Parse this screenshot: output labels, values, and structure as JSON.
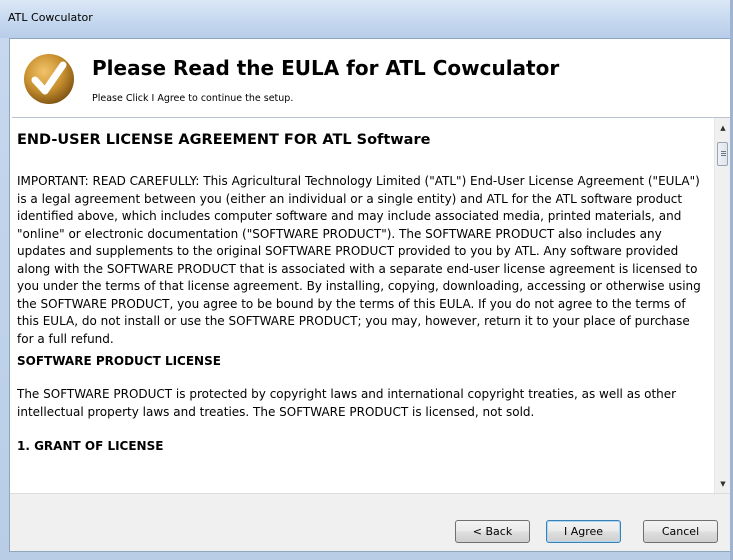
{
  "window": {
    "title": "ATL Cowculator"
  },
  "header": {
    "title": "Please Read the EULA for ATL Cowculator",
    "subtitle": "Please Click I Agree to continue the setup.",
    "logo_icon": "checkmark-logo-icon"
  },
  "eula": {
    "heading": "END-USER LICENSE AGREEMENT FOR ATL Software",
    "paragraph1": "IMPORTANT: READ CAREFULLY: This Agricultural Technology Limited (\"ATL\") End-User License Agreement (\"EULA\") is a legal agreement between you (either an individual or a single entity) and ATL for the ATL software product identified above, which includes computer software and may include associated media, printed materials, and \"online\" or electronic documentation (\"SOFTWARE PRODUCT\"). The SOFTWARE PRODUCT also includes any updates and supplements to the original SOFTWARE PRODUCT provided to you by ATL. Any software provided along with the SOFTWARE PRODUCT that is associated with a separate end-user license agreement is licensed to you under the terms of that license agreement. By installing, copying, downloading, accessing or otherwise using the SOFTWARE PRODUCT, you agree to be bound by the terms of this EULA. If you do not agree to the terms of this EULA, do not install or use the SOFTWARE PRODUCT; you may, however, return it to your place of purchase for a full refund.",
    "section1_heading": "SOFTWARE PRODUCT LICENSE",
    "paragraph2": "The SOFTWARE PRODUCT is protected by copyright laws and international copyright treaties, as well as other intellectual property laws and treaties. The SOFTWARE PRODUCT is licensed, not sold.",
    "section2_heading": "1. GRANT OF LICENSE"
  },
  "buttons": {
    "back": "< Back",
    "agree": "I Agree",
    "cancel": "Cancel"
  },
  "colors": {
    "accent_blue": "#3c7fb1",
    "logo_gold": "#c8902e"
  }
}
